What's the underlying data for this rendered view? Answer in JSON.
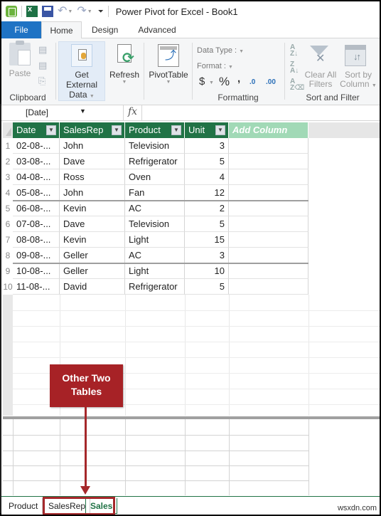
{
  "titlebar": {
    "title": "Power Pivot for Excel - Book1",
    "icons": [
      "power-pivot-icon",
      "excel-icon",
      "save-icon",
      "undo-icon",
      "redo-icon",
      "customize-toolbar-icon"
    ]
  },
  "tabs": [
    {
      "label": "File"
    },
    {
      "label": "Home",
      "active": true
    },
    {
      "label": "Design"
    },
    {
      "label": "Advanced"
    }
  ],
  "ribbon": {
    "clipboard": {
      "paste_label": "Paste",
      "group_label": "Clipboard"
    },
    "get_external_data": {
      "line1": "Get External",
      "line2": "Data"
    },
    "refresh_label": "Refresh",
    "pivottable_label": "PivotTable",
    "formatting": {
      "data_type_label": "Data Type :",
      "format_label": "Format :",
      "currency_symbol": "$",
      "percent_symbol": "%",
      "comma_symbol": ",",
      "increase_decimal": ".0",
      "decrease_decimal": ".00",
      "group_label": "Formatting"
    },
    "sort_filter": {
      "sort_az": "A↓Z",
      "sort_za": "Z↓A",
      "clear_sort": "A/Z",
      "clear_filters_line1": "Clear All",
      "clear_filters_line2": "Filters",
      "sort_by_column_line1": "Sort by",
      "sort_by_column_line2": "Column",
      "group_label": "Sort and Filter"
    }
  },
  "formula_bar": {
    "name_box": "[Date]",
    "fx": "fx",
    "formula": ""
  },
  "table": {
    "columns": [
      "Date",
      "SalesRep",
      "Product",
      "Unit"
    ],
    "add_column_label": "Add Column",
    "rows": [
      {
        "n": "1",
        "date": "02-08-...",
        "rep": "John",
        "product": "Television",
        "unit": "3"
      },
      {
        "n": "2",
        "date": "03-08-...",
        "rep": "Dave",
        "product": "Refrigerator",
        "unit": "5"
      },
      {
        "n": "3",
        "date": "04-08-...",
        "rep": "Ross",
        "product": "Oven",
        "unit": "4"
      },
      {
        "n": "4",
        "date": "05-08-...",
        "rep": "John",
        "product": "Fan",
        "unit": "12"
      },
      {
        "n": "5",
        "date": "06-08-...",
        "rep": "Kevin",
        "product": "AC",
        "unit": "2"
      },
      {
        "n": "6",
        "date": "07-08-...",
        "rep": "Dave",
        "product": "Television",
        "unit": "5"
      },
      {
        "n": "7",
        "date": "08-08-...",
        "rep": "Kevin",
        "product": "Light",
        "unit": "15"
      },
      {
        "n": "8",
        "date": "09-08-...",
        "rep": "Geller",
        "product": "AC",
        "unit": "3"
      },
      {
        "n": "9",
        "date": "10-08-...",
        "rep": "Geller",
        "product": "Light",
        "unit": "10"
      },
      {
        "n": "10",
        "date": "11-08-...",
        "rep": "David",
        "product": "Refrigerator",
        "unit": "5"
      }
    ]
  },
  "sheet_tabs": [
    {
      "label": "Product"
    },
    {
      "label": "SalesRep"
    },
    {
      "label": "Sales",
      "active": true
    }
  ],
  "callout": {
    "line1": "Other Two",
    "line2": "Tables",
    "color": "#a72226"
  },
  "watermark": "wsxdn.com",
  "colors": {
    "header_green": "#217346",
    "add_column_green": "#a1d9b6",
    "file_tab_blue": "#1f73c4"
  }
}
